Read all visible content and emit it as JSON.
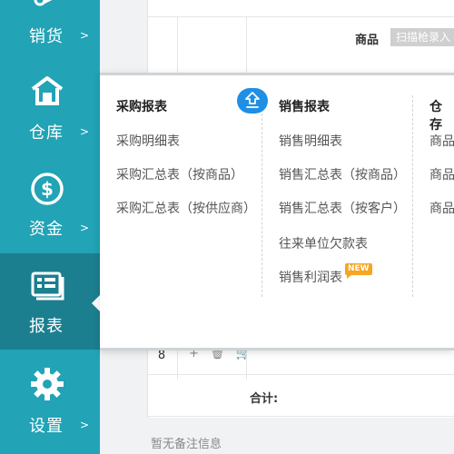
{
  "sidebar": {
    "items": [
      {
        "label": "销货",
        "icon": "key-icon"
      },
      {
        "label": "仓库",
        "icon": "warehouse-icon"
      },
      {
        "label": "资金",
        "icon": "dollar-circle-icon"
      },
      {
        "label": "报表",
        "icon": "report-icon",
        "active": true
      },
      {
        "label": "设置",
        "icon": "gear-icon"
      }
    ],
    "arrow": ">"
  },
  "table": {
    "product_header": "商品",
    "scan_placeholder": "扫描枪录入",
    "rows": [
      {
        "num": "8",
        "actions": "+ 🗑 🛒"
      }
    ],
    "total_label": "合计:",
    "note": "暂无备注信息"
  },
  "menu": {
    "purchase": {
      "title": "采购报表",
      "links": [
        "采购明细表",
        "采购汇总表（按商品）",
        "采购汇总表（按供应商）"
      ]
    },
    "sales": {
      "title": "销售报表",
      "links": [
        "销售明细表",
        "销售汇总表（按商品）",
        "销售汇总表（按客户）",
        "往来单位欠款表",
        "销售利润表"
      ],
      "new_badge": "NEW"
    },
    "warehouse": {
      "title": "仓存",
      "links": [
        "商品",
        "商品",
        "商品"
      ]
    }
  },
  "colors": {
    "sidebar_bg": "#22a3b6",
    "sidebar_active": "#1c7f8f",
    "badge": "#f5a623",
    "collapse_button": "#1f8fe6"
  }
}
